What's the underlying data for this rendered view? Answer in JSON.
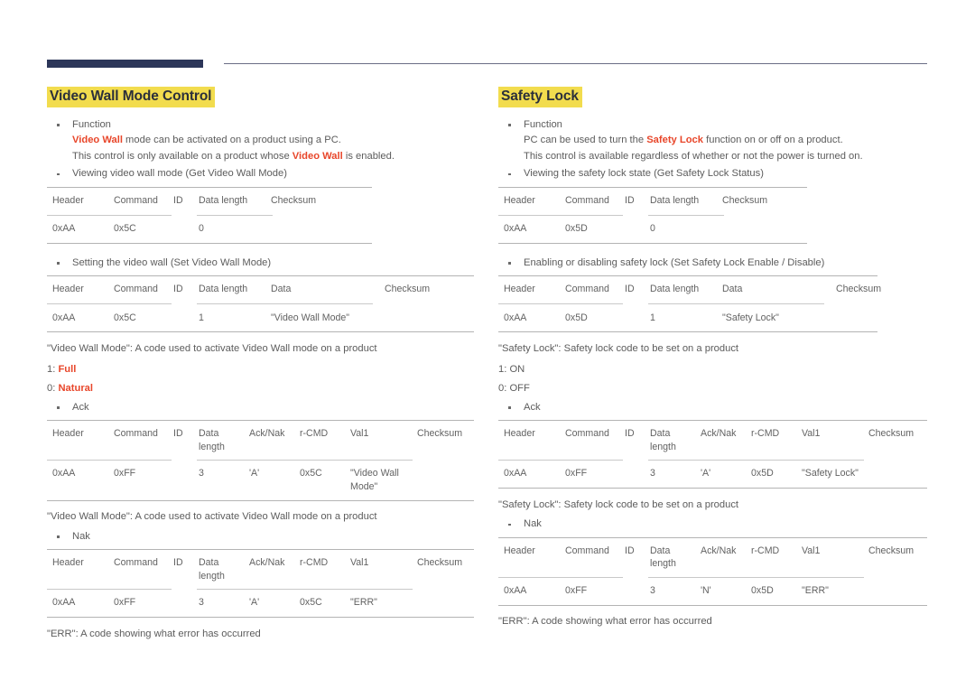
{
  "document": {
    "header_rule": {
      "bar_color": "#2c3659",
      "line_color": "#6b6e85"
    },
    "accent_color": "#e8462a",
    "highlight_color": "#f2dc4e"
  },
  "left": {
    "title": "Video Wall Mode Control",
    "function_bullet": {
      "label": "Function",
      "line2_pre": "",
      "line2_accent": "Video Wall",
      "line2_post": " mode can be activated on a product using a PC.",
      "line3_pre": "This control is only available on a product whose ",
      "line3_accent": "Video Wall",
      "line3_post": " is enabled."
    },
    "get_bullet": "Viewing video wall mode (Get Video Wall Mode)",
    "get_table": {
      "columns": [
        "Header",
        "Command",
        "ID",
        "Data length",
        "Checksum"
      ],
      "row": [
        "0xAA",
        "0x5C",
        "",
        "0",
        ""
      ]
    },
    "set_bullet": "Setting the video wall (Set Video Wall Mode)",
    "set_table": {
      "columns": [
        "Header",
        "Command",
        "ID",
        "Data length",
        "Data",
        "Checksum"
      ],
      "row": [
        "0xAA",
        "0x5C",
        "",
        "1",
        "\"Video Wall Mode\"",
        ""
      ]
    },
    "set_note": "\"Video Wall Mode\": A code used to activate Video Wall mode on a product",
    "codes": [
      {
        "key": "1:",
        "value": "Full"
      },
      {
        "key": "0:",
        "value": "Natural"
      }
    ],
    "ack_bullet": "Ack",
    "ack_table": {
      "columns": [
        "Header",
        "Command",
        "ID",
        "Data length",
        "Ack/Nak",
        "r-CMD",
        "Val1",
        "Checksum"
      ],
      "row": [
        "0xAA",
        "0xFF",
        "",
        "3",
        "'A'",
        "0x5C",
        "\"Video Wall Mode\"",
        ""
      ]
    },
    "ack_note": "\"Video Wall Mode\": A code used to activate Video Wall mode on a product",
    "nak_bullet": "Nak",
    "nak_table": {
      "columns": [
        "Header",
        "Command",
        "ID",
        "Data length",
        "Ack/Nak",
        "r-CMD",
        "Val1",
        "Checksum"
      ],
      "row": [
        "0xAA",
        "0xFF",
        "",
        "3",
        "'A'",
        "0x5C",
        "\"ERR\"",
        ""
      ]
    },
    "nak_note": "\"ERR\": A code showing what error has occurred"
  },
  "right": {
    "title": "Safety Lock",
    "function_bullet": {
      "label": "Function",
      "line2_pre": "PC can be used to turn the ",
      "line2_accent": "Safety Lock",
      "line2_post": " function on or off on a product.",
      "line3_pre": "This control is available regardless of whether or not the power is turned on.",
      "line3_accent": "",
      "line3_post": ""
    },
    "get_bullet": "Viewing the safety lock state (Get Safety Lock Status)",
    "get_table": {
      "columns": [
        "Header",
        "Command",
        "ID",
        "Data length",
        "Checksum"
      ],
      "row": [
        "0xAA",
        "0x5D",
        "",
        "0",
        ""
      ]
    },
    "set_bullet": "Enabling or disabling safety lock (Set Safety Lock Enable / Disable)",
    "set_table": {
      "columns": [
        "Header",
        "Command",
        "ID",
        "Data length",
        "Data",
        "Checksum"
      ],
      "row": [
        "0xAA",
        "0x5D",
        "",
        "1",
        "\"Safety Lock\"",
        ""
      ]
    },
    "set_note": "\"Safety Lock\": Safety lock code to be set on a product",
    "codes": [
      {
        "key": "1:",
        "value": "ON"
      },
      {
        "key": "0:",
        "value": "OFF"
      }
    ],
    "ack_bullet": "Ack",
    "ack_table": {
      "columns": [
        "Header",
        "Command",
        "ID",
        "Data length",
        "Ack/Nak",
        "r-CMD",
        "Val1",
        "Checksum"
      ],
      "row": [
        "0xAA",
        "0xFF",
        "",
        "3",
        "'A'",
        "0x5D",
        "\"Safety Lock\"",
        ""
      ]
    },
    "ack_note": "\"Safety Lock\": Safety lock code to be set on a product",
    "nak_bullet": "Nak",
    "nak_table": {
      "columns": [
        "Header",
        "Command",
        "ID",
        "Data length",
        "Ack/Nak",
        "r-CMD",
        "Val1",
        "Checksum"
      ],
      "row": [
        "0xAA",
        "0xFF",
        "",
        "3",
        "'N'",
        "0x5D",
        "\"ERR\"",
        ""
      ]
    },
    "nak_note": "\"ERR\": A code showing what error has occurred"
  }
}
